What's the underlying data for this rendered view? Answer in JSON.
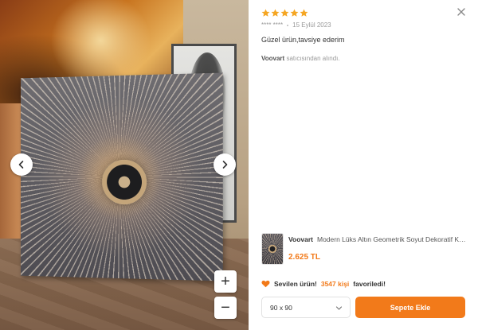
{
  "review": {
    "rating": 5,
    "max_rating": 5,
    "author": "**** ****",
    "date": "15 Eylül 2023",
    "text": "Güzel ürün,tavsiye ederim",
    "seller_name": "Voovart",
    "seller_suffix": "satıcısından alındı."
  },
  "product": {
    "brand": "Voovart",
    "name": "Modern Lüks Altın Geometrik Soyut Dekoratif Kanvas Tablo",
    "price": "2.625 TL"
  },
  "favorites": {
    "prefix": "Sevilen ürün!",
    "count_text": "3547 kişi",
    "suffix": "favoriledi!"
  },
  "size_select": {
    "selected": "90 x 90"
  },
  "add_to_cart_label": "Sepete Ekle",
  "zoom": {
    "in_label": "+",
    "out_label": "−"
  },
  "colors": {
    "accent": "#f27a1a",
    "star": "#f5a623"
  },
  "icons": {
    "close": "close-icon",
    "prev": "chevron-left-icon",
    "next": "chevron-right-icon",
    "heart": "heart-icon",
    "dropdown": "chevron-down-icon"
  }
}
